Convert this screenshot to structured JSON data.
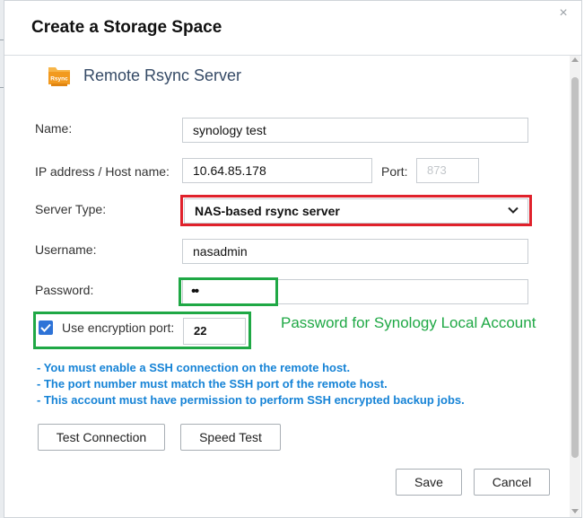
{
  "dialog": {
    "title": "Create a Storage Space",
    "close_glyph": "×"
  },
  "section": {
    "title": "Remote Rsync Server",
    "icon": "rsync-folder-icon",
    "icon_text": "Rsync",
    "icon_color": "#f29a1f"
  },
  "form": {
    "name_label": "Name:",
    "name_value": "synology test",
    "host_label": "IP address / Host name:",
    "host_value": "10.64.85.178",
    "port_label": "Port:",
    "port_value": "873",
    "server_type_label": "Server Type:",
    "server_type_value": "NAS-based rsync server",
    "username_label": "Username:",
    "username_value": "nasadmin",
    "password_label": "Password:",
    "password_value": "••",
    "encryption_label": "Use encryption port:",
    "encryption_checked": true,
    "encryption_port_value": "22"
  },
  "annotation": {
    "text": "Password for Synology Local Account",
    "color": "#1fa845"
  },
  "notes": [
    "- You must enable a SSH connection on the remote host.",
    "- The port number must match the SSH port of the remote host.",
    "- This account must have permission to perform SSH encrypted backup jobs."
  ],
  "buttons": {
    "test_connection": "Test Connection",
    "speed_test": "Speed Test",
    "save": "Save",
    "cancel": "Cancel"
  },
  "colors": {
    "highlight_red": "#e0212b",
    "highlight_green": "#1fa845",
    "note_blue": "#1683d6",
    "checkbox_blue": "#2e73d7"
  }
}
